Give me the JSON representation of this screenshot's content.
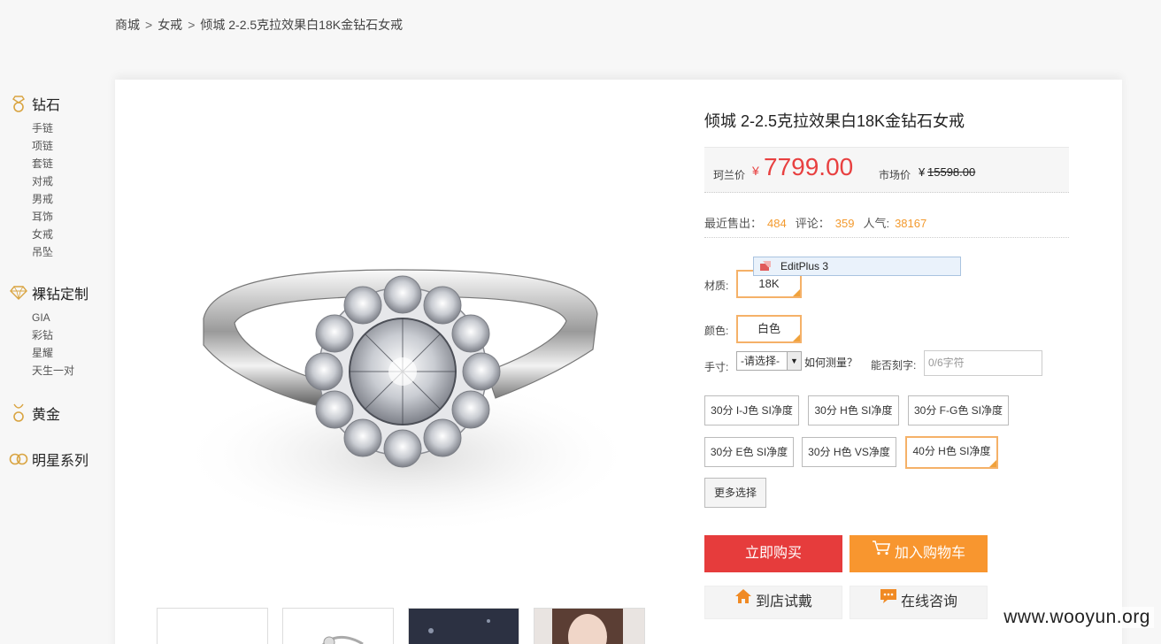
{
  "breadcrumb": {
    "items": [
      "商城",
      "女戒",
      "倾城 2-2.5克拉效果白18K金钻石女戒"
    ],
    "sep": ">"
  },
  "sidebar": {
    "categories": [
      {
        "title": "钻石",
        "icon": "diamond-ring-icon",
        "items": [
          "手链",
          "项链",
          "套链",
          "对戒",
          "男戒",
          "耳饰",
          "女戒",
          "吊坠"
        ]
      },
      {
        "title": "裸钻定制",
        "icon": "diamond-icon",
        "items": [
          "GIA",
          "彩钻",
          "星耀",
          "天生一对"
        ]
      },
      {
        "title": "黄金",
        "icon": "gold-pendant-icon",
        "items": []
      },
      {
        "title": "明星系列",
        "icon": "rings-icon",
        "items": []
      }
    ]
  },
  "product": {
    "title": "倾城 2-2.5克拉效果白18K金钻石女戒",
    "price_label": "珂兰价",
    "currency": "¥",
    "price": "7799.00",
    "market_label": "市场价",
    "market_price": "15598.00",
    "stats": {
      "sold_label": "最近售出：",
      "sold": "484",
      "review_label": "评论：",
      "reviews": "359",
      "popularity_label": "人气:",
      "popularity": "38167"
    },
    "material_label": "材质:",
    "material": "18K",
    "color_label": "颜色:",
    "color": "白色",
    "size_label": "手寸:",
    "size_select": "-请选择-",
    "measure_link": "如何测量？",
    "engrave_label": "能否刻字:",
    "engrave_placeholder": "0/6字符",
    "specs": [
      "30分 I-J色 SI净度",
      "30分 H色 SI净度",
      "30分 F-G色 SI净度",
      "30分 E色 SI净度",
      "30分 H色 VS净度",
      "40分 H色 SI净度"
    ],
    "more_label": "更多选择",
    "buy_label": "立即购买",
    "cart_label": "加入购物车",
    "store_label": "到店试戴",
    "consult_label": "在线咨询"
  },
  "tooltip": {
    "text": "EditPlus 3"
  },
  "watermark": "www.wooyun.org",
  "colors": {
    "price_red": "#e63c3c",
    "accent_orange": "#f8962f",
    "highlight_border": "#f5b168",
    "stat_orange": "#f39a2e"
  }
}
